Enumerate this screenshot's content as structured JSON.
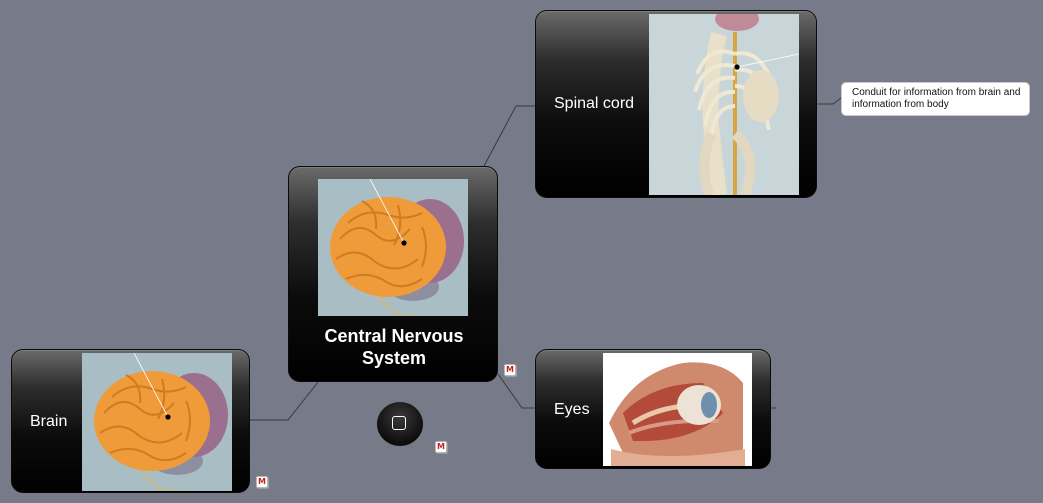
{
  "central": {
    "label": "Central Nervous System"
  },
  "nodes": {
    "spinal_cord": {
      "label": "Spinal cord"
    },
    "brain": {
      "label": "Brain"
    },
    "eyes": {
      "label": "Eyes"
    }
  },
  "note": {
    "text": "Conduit for information from brain and information from body"
  },
  "icons": {
    "note_badge": "M",
    "fab": "square-icon"
  }
}
